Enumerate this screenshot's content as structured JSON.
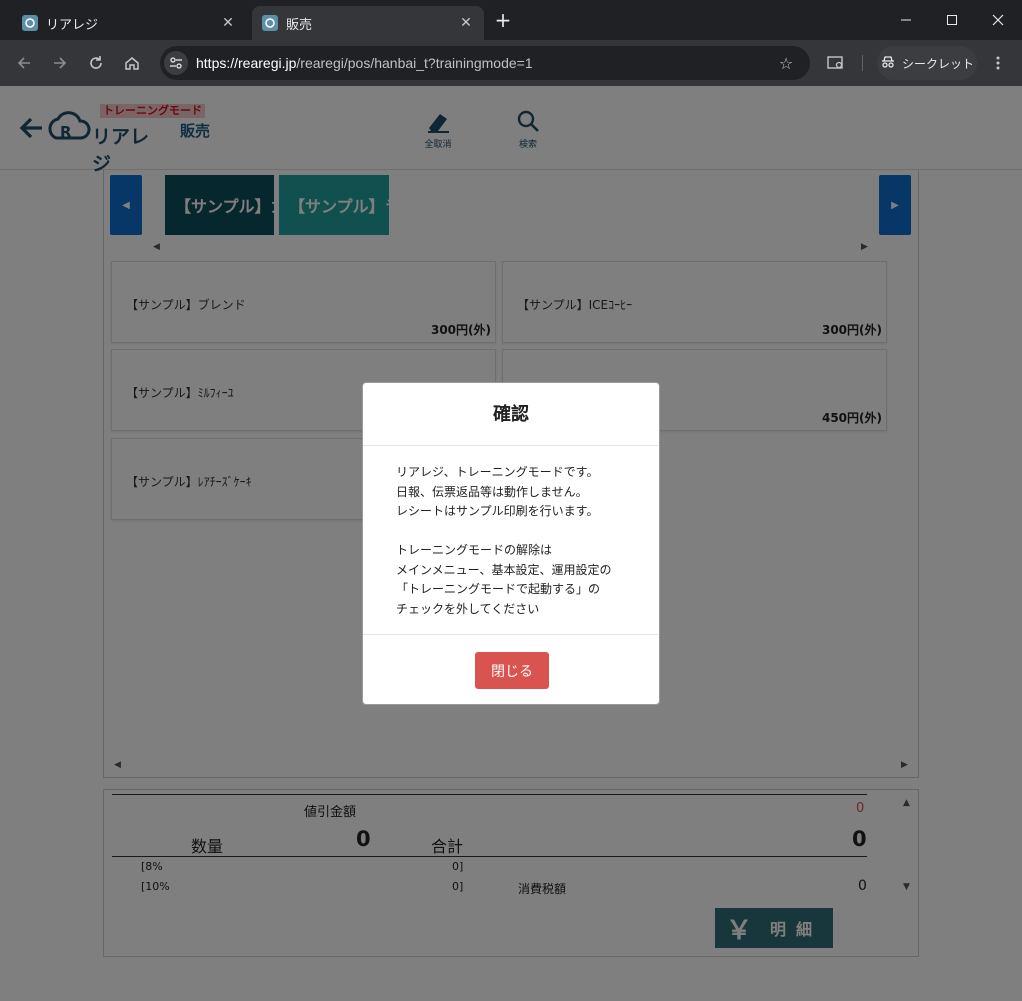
{
  "browser": {
    "tabs": [
      {
        "title": "リアレジ",
        "active": false
      },
      {
        "title": "販売",
        "active": true
      }
    ],
    "url_host": "https://rearegi.jp",
    "url_path": "/rearegi/pos/hanbai_t?trainingmode=1",
    "incognito_label": "シークレット"
  },
  "header": {
    "training_label": "トレーニングモード",
    "screen_title": "販売",
    "logo_text": "リアレジ",
    "clear_all_label": "全取消",
    "search_label": "検索"
  },
  "categories": [
    {
      "label": "【サンプル】カ",
      "color": "#0e4f5e"
    },
    {
      "label": "【サンプル】ラ",
      "color": "#20a39e"
    }
  ],
  "products": [
    {
      "name": "【サンプル】ブレンド",
      "price": "300円(外)"
    },
    {
      "name": "【サンプル】ICEｺｰﾋｰ",
      "price": "300円(外)"
    },
    {
      "name": "【サンプル】ﾐﾙﾌｨｰﾕ",
      "price": ""
    },
    {
      "name": "",
      "price": "450円(外)"
    },
    {
      "name": "【サンプル】ﾚｱﾁｰｽﾞｹｰｷ",
      "price": ""
    }
  ],
  "summary": {
    "discount_label": "値引金額",
    "discount_value": "0",
    "quantity_label": "数量",
    "quantity_value": "0",
    "total_label": "合計",
    "total_value": "0",
    "tax8_label": "[8%",
    "tax8_value": "0]",
    "tax10_label": "[10%",
    "tax10_value": "0]",
    "tax_label": "消費税額",
    "tax_value": "0",
    "details_button": "明細",
    "yen_symbol": "￥"
  },
  "modal": {
    "title": "確認",
    "body_1": "リアレジ、トレーニングモードです。\n日報、伝票返品等は動作しません。\nレシートはサンプル印刷を行います。",
    "body_2": "トレーニングモードの解除は\nメインメニュー、基本設定、運用設定の\n「トレーニングモードで起動する」の\nチェックを外してください",
    "close_label": "閉じる"
  },
  "colors": {
    "accent_blue": "#0d6fcf",
    "close_button": "#d9534f",
    "details_button": "#2f6f7a",
    "discount_red": "#d9534f"
  }
}
